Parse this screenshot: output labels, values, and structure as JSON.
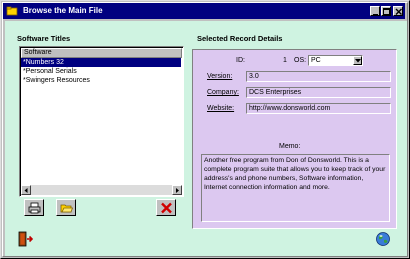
{
  "window": {
    "title": "Browse the Main File"
  },
  "left_panel": {
    "title": "Software Titles",
    "column_header": "Software",
    "items": [
      {
        "label": "*Numbers 32",
        "selected": true
      },
      {
        "label": "*Personal Serials",
        "selected": false
      },
      {
        "label": "*Swingers Resources",
        "selected": false
      }
    ]
  },
  "right_panel": {
    "title": "Selected Record Details",
    "id_label": "ID:",
    "id_value": "1",
    "os_label": "OS:",
    "os_value": "PC",
    "version_label": "Version:",
    "version_value": "3.0",
    "company_label": "Company:",
    "company_value": "DCS Enterprises",
    "website_label": "Website:",
    "website_value": "http://www.donsworld.com",
    "memo_label": "Memo:",
    "memo_value": "Another free program from Don of Donsworld. This is a complete program suite that allows you to keep track of your address's and phone numbers, Software information, Internet connection information and more."
  },
  "colors": {
    "titlebar": "#000080",
    "client_bg": "#cff3e1",
    "details_bg": "#dcc8f0",
    "selection": "#000080"
  },
  "icons": {
    "app": "folder-app-icon",
    "print": "print-icon",
    "open": "open-folder-icon",
    "delete": "delete-x-icon",
    "exit": "exit-door-icon",
    "web": "globe-icon"
  }
}
